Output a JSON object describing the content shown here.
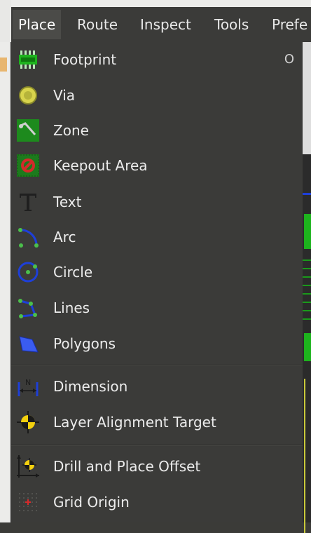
{
  "menubar": {
    "items": [
      "Place",
      "Route",
      "Inspect",
      "Tools",
      "Prefe"
    ],
    "active": "Place"
  },
  "place_menu": {
    "items": [
      {
        "label": "Footprint",
        "shortcut": "O",
        "icon": "footprint-icon"
      },
      {
        "label": "Via",
        "icon": "via-icon"
      },
      {
        "label": "Zone",
        "icon": "zone-icon"
      },
      {
        "label": "Keepout Area",
        "icon": "keepout-area-icon"
      },
      {
        "label": "Text",
        "icon": "text-icon"
      },
      {
        "label": "Arc",
        "icon": "arc-icon"
      },
      {
        "label": "Circle",
        "icon": "circle-icon"
      },
      {
        "label": "Lines",
        "icon": "lines-icon"
      },
      {
        "label": "Polygons",
        "icon": "polygons-icon"
      },
      {
        "label": "Dimension",
        "icon": "dimension-icon"
      },
      {
        "label": "Layer Alignment Target",
        "icon": "layer-alignment-target-icon"
      },
      {
        "label": "Drill and Place Offset",
        "icon": "drill-and-place-offset-icon"
      },
      {
        "label": "Grid Origin",
        "icon": "grid-origin-icon"
      }
    ]
  },
  "colors": {
    "menu_bg": "#3b3b39",
    "active_menu_bg": "#4b4b48",
    "pcb_green": "#1db31d",
    "dimension_blue": "#1e3fd8",
    "keepout_red": "#d42a2a",
    "target_yellow": "#f3d00e"
  }
}
